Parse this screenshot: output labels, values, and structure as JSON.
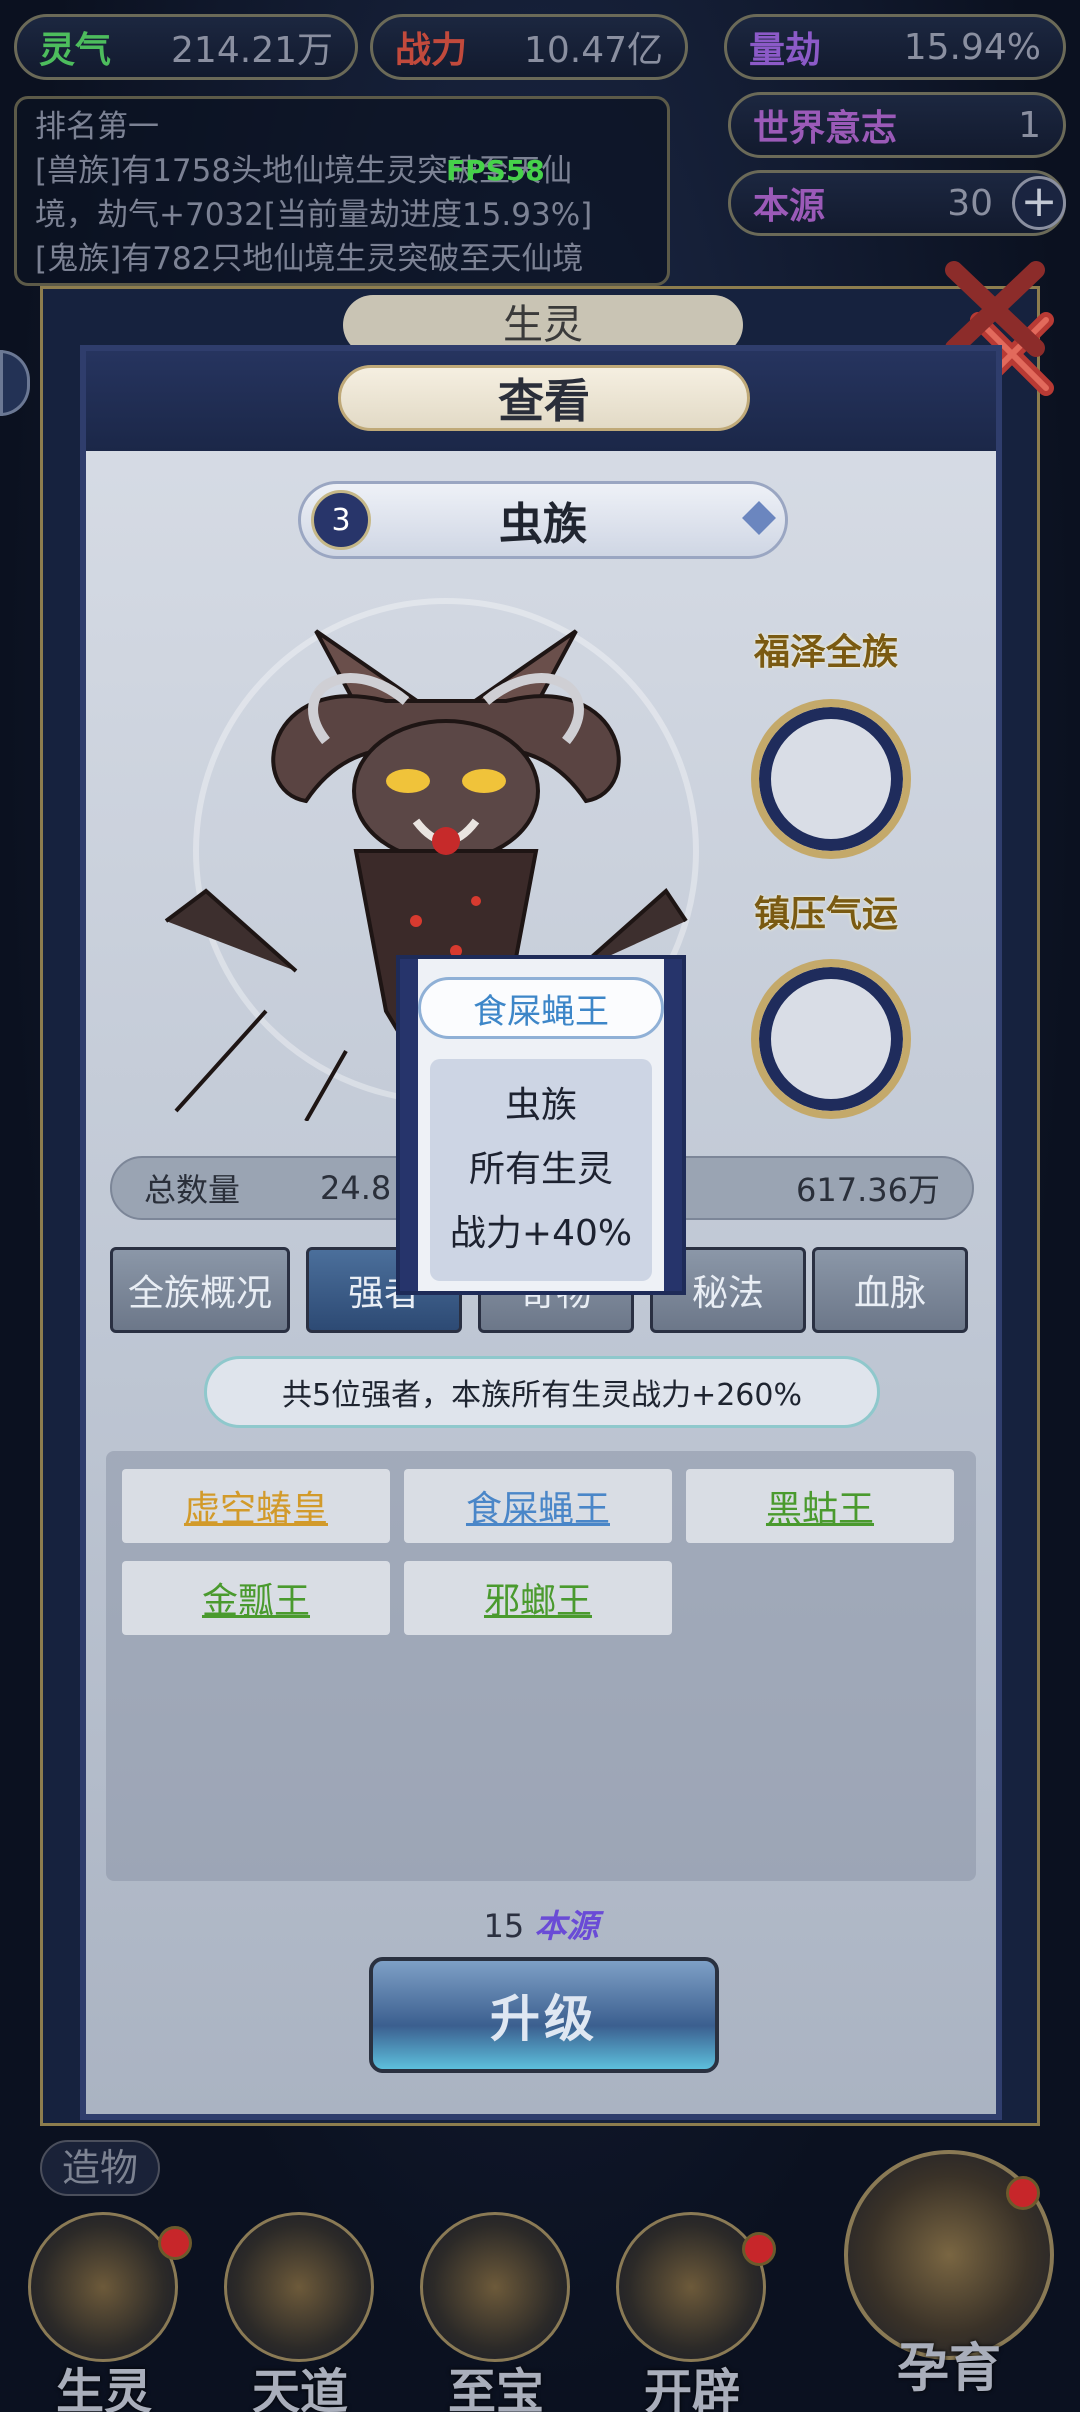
{
  "top_bar": {
    "lingqi": {
      "label": "灵气",
      "value": "214.21万"
    },
    "zhanli": {
      "label": "战力",
      "value": "10.47亿"
    },
    "liangjie": {
      "label": "量劫",
      "value": "15.94%"
    },
    "world_will": {
      "label": "世界意志",
      "value": "1"
    },
    "origin": {
      "label": "本源",
      "value": "30"
    }
  },
  "fps": "FPS58",
  "log": {
    "heading": "排名第一",
    "line1": "[兽族]有1758头地仙境生灵突破至天仙",
    "line2": "境，劫气+7032[当前量劫进度15.93%]",
    "line3": "[鬼族]有782只地仙境生灵突破至天仙境"
  },
  "back_panel_title": "生灵",
  "dialog": {
    "title": "查看",
    "race_number": "3",
    "race_name": "虫族",
    "side_slot_1": "福泽全族",
    "side_slot_2": "镇压气运",
    "total_label": "总数量",
    "total_value": "24.8",
    "right_value": "617.36万",
    "tabs": [
      "全族概况",
      "强者",
      "奇物",
      "秘法",
      "血脉"
    ],
    "summary": "共5位强者，本族所有生灵战力+260%",
    "heroes": [
      {
        "name": "虚空蝽皇",
        "color": "#d29a2a"
      },
      {
        "name": "食屎蝇王",
        "color": "#4a86c8"
      },
      {
        "name": "黑蛄王",
        "color": "#4a9a2e"
      },
      {
        "name": "金瓢王",
        "color": "#4a9a2e"
      },
      {
        "name": "邪螂王",
        "color": "#4a9a2e"
      }
    ],
    "cost_amount": "15",
    "cost_unit": "本源",
    "upgrade": "升级"
  },
  "popup": {
    "title": "食屎蝇王",
    "line1": "虫族",
    "line2": "所有生灵",
    "line3": "战力+40%"
  },
  "bottom": {
    "zaowu": "造物",
    "nav": [
      "生灵",
      "天道",
      "至宝",
      "开辟",
      "孕育"
    ]
  }
}
